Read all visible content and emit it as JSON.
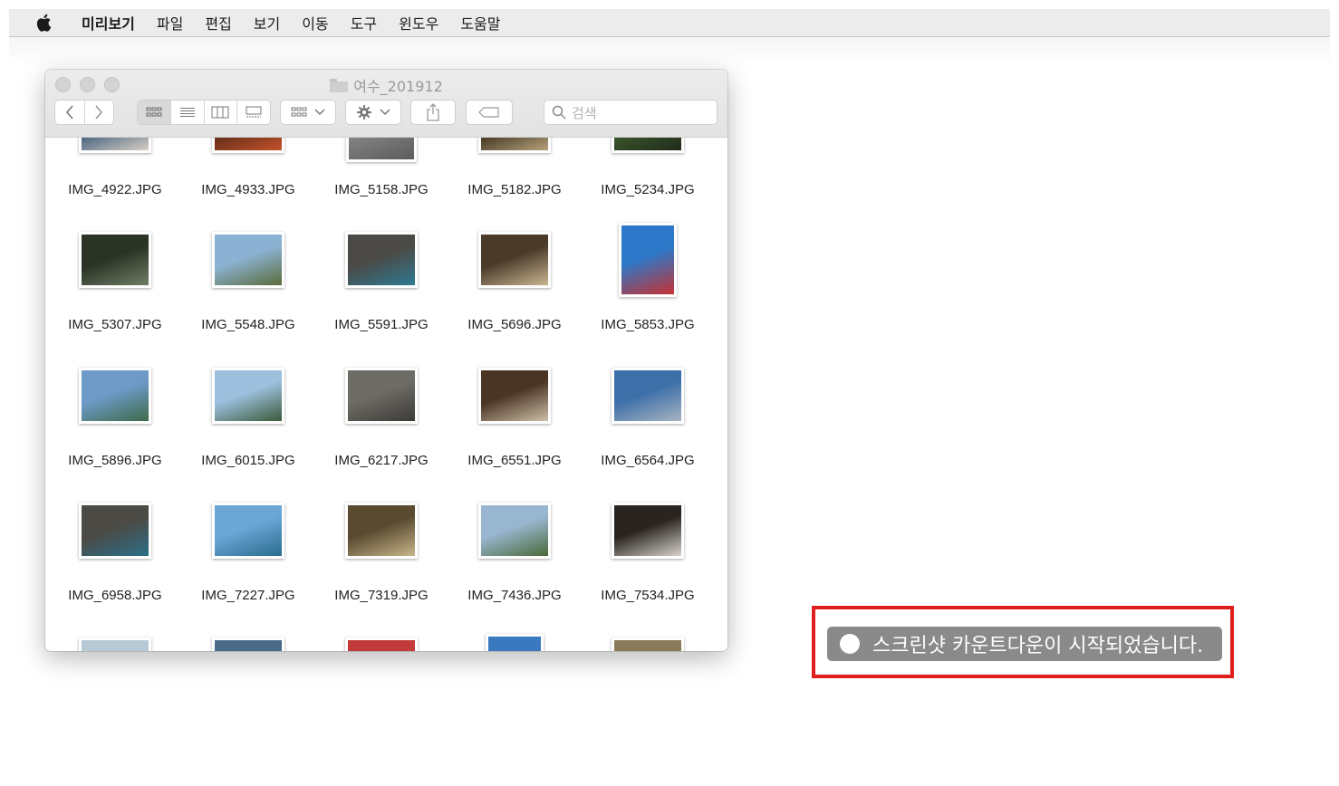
{
  "menubar": {
    "apple_icon": "apple-logo-icon",
    "app_name": "미리보기",
    "items": [
      "파일",
      "편집",
      "보기",
      "이동",
      "도구",
      "윈도우",
      "도움말"
    ]
  },
  "finder": {
    "title": "여수_201912",
    "search_placeholder": "검색",
    "rows": [
      [
        {
          "name": "IMG_4922.JPG",
          "c1": "#3a5a7a",
          "c2": "#d9d0c4"
        },
        {
          "name": "IMG_4933.JPG",
          "c1": "#5a2a18",
          "c2": "#c4522a"
        },
        {
          "name": "IMG_5158.JPG",
          "c1": "#8a8a8a",
          "c2": "#5c5c5c"
        },
        {
          "name": "IMG_5182.JPG",
          "c1": "#3a2d1c",
          "c2": "#b6a27a"
        },
        {
          "name": "IMG_5234.JPG",
          "c1": "#3e5a2e",
          "c2": "#1f2b1a"
        }
      ],
      [
        {
          "name": "IMG_5307.JPG",
          "c1": "#2a3324",
          "c2": "#6e7d66"
        },
        {
          "name": "IMG_5548.JPG",
          "c1": "#8bb2d2",
          "c2": "#5a6b3a"
        },
        {
          "name": "IMG_5591.JPG",
          "c1": "#4b4a46",
          "c2": "#2f7a92"
        },
        {
          "name": "IMG_5696.JPG",
          "c1": "#4a3a2a",
          "c2": "#c9b690"
        },
        {
          "name": "IMG_5853.JPG",
          "c1": "#2d78c9",
          "c2": "#c43131"
        }
      ],
      [
        {
          "name": "IMG_5896.JPG",
          "c1": "#6d9ac7",
          "c2": "#3e6a4a"
        },
        {
          "name": "IMG_6015.JPG",
          "c1": "#9cc0de",
          "c2": "#3b5a3a"
        },
        {
          "name": "IMG_6217.JPG",
          "c1": "#6e6c66",
          "c2": "#3c3a36"
        },
        {
          "name": "IMG_6551.JPG",
          "c1": "#4a3424",
          "c2": "#cdbfa8"
        },
        {
          "name": "IMG_6564.JPG",
          "c1": "#3d6fa8",
          "c2": "#a7b4c2"
        }
      ],
      [
        {
          "name": "IMG_6958.JPG",
          "c1": "#4c4a44",
          "c2": "#2b6e88"
        },
        {
          "name": "IMG_7227.JPG",
          "c1": "#6aa6d6",
          "c2": "#2a6c8e"
        },
        {
          "name": "IMG_7319.JPG",
          "c1": "#5a4a30",
          "c2": "#c7b68a"
        },
        {
          "name": "IMG_7436.JPG",
          "c1": "#98b6cf",
          "c2": "#4a6a3a"
        },
        {
          "name": "IMG_7534.JPG",
          "c1": "#2a2420",
          "c2": "#d8d4cc"
        }
      ],
      [
        {
          "name": "",
          "c1": "#b8c9d6",
          "c2": "#8aa0b0"
        },
        {
          "name": "",
          "c1": "#4a6a8a",
          "c2": "#3a4a2a"
        },
        {
          "name": "",
          "c1": "#c23a3a",
          "c2": "#e8e8e8"
        },
        {
          "name": "",
          "c1": "#3a78c0",
          "c2": "#5a92d0"
        },
        {
          "name": "",
          "c1": "#8a7a5a",
          "c2": "#c0b090"
        }
      ]
    ]
  },
  "notification": {
    "text": "스크린샷 카운트다운이 시작되었습니다.",
    "highlight_color": "#e01e1e"
  }
}
